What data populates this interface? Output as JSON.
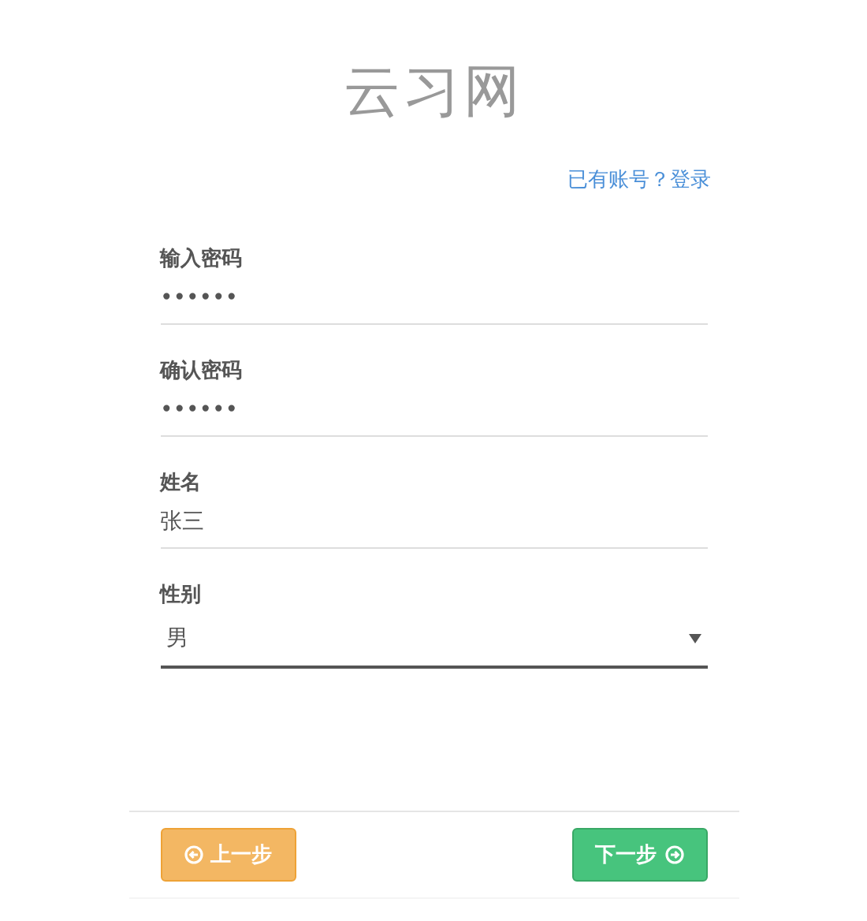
{
  "title": "云习网",
  "login_link": "已有账号？登录",
  "fields": [
    {
      "kind": "password",
      "label": "输入密码",
      "value": "••••••"
    },
    {
      "kind": "text",
      "label": "确认密码",
      "value": "••••••"
    },
    {
      "kind": "text",
      "label": "姓名",
      "value": "张三"
    },
    {
      "kind": "select",
      "label": "性别",
      "value": "男"
    }
  ],
  "buttons": [
    {
      "kind": "prev",
      "label": "上一步"
    },
    {
      "kind": "next",
      "label": "下一步"
    }
  ]
}
